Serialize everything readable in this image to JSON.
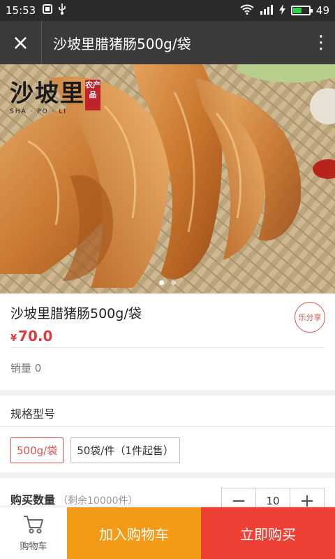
{
  "status_bar": {
    "time": "15:53",
    "battery": "49",
    "battery_level": 0.49
  },
  "nav": {
    "close_label": "×",
    "title": "沙坡里腊猪肠500g/袋",
    "more_label": "⋮"
  },
  "banner": {
    "logo_text": "沙坡里",
    "logo_stamp": "农产品",
    "logo_sub": "SHA · PO · LI",
    "slide_count": 2,
    "active_slide": 1
  },
  "product": {
    "name": "沙坡里腊猪肠500g/袋",
    "currency": "¥",
    "price": "70.0",
    "share_label": "乐分享",
    "sales": "销量 0"
  },
  "spec": {
    "title": "规格型号",
    "options": [
      {
        "label": "500g/袋",
        "selected": true
      },
      {
        "label": "50袋/件（1件起售）",
        "selected": false
      }
    ]
  },
  "quantity": {
    "label": "购买数量",
    "remaining": "（剩余10000件）",
    "minus_label": "−",
    "value": "10",
    "plus_label": "+"
  },
  "bottom_bar": {
    "cart_label": "购物车",
    "add_to_cart": "加入购物车",
    "buy_now": "立即购买"
  },
  "colors": {
    "accent_red": "#e4393c",
    "orange": "#f39b17",
    "buy_red": "#ef4035",
    "nav_bg": "#3a3a3a"
  },
  "icons": [
    "usb-icon",
    "wifi-icon",
    "signal-icon",
    "battery-icon",
    "close-icon",
    "more-icon",
    "cart-icon"
  ]
}
